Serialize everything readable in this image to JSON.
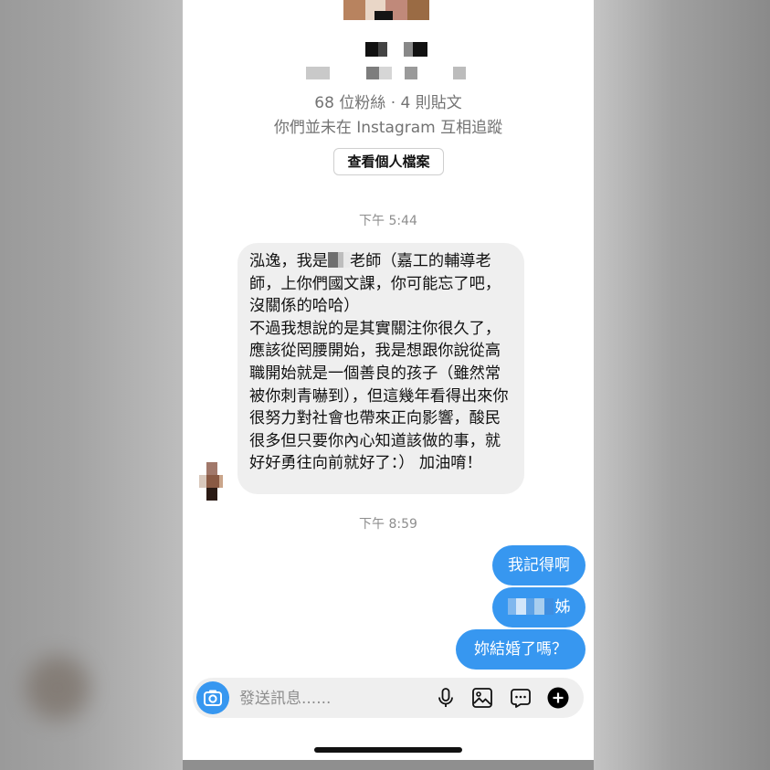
{
  "profile": {
    "stats": "68 位粉絲 · 4 則貼文",
    "mutual_status": "你們並未在 Instagram 互相追蹤",
    "view_profile_label": "查看個人檔案"
  },
  "conversation": {
    "time_1": "下午 5:44",
    "incoming_message": {
      "line1_a": "泓逸，我是",
      "line1_b": "老師（嘉工的輔導老師，上你們國文課，你可能忘了吧，沒關係的哈哈）",
      "para2": "不過我想說的是其實關注你很久了，應該從罔腰開始，我是想跟你說從高職開始就是一個善良的孩子（雖然常被你刺青嚇到），但這幾年看得出來你很努力對社會也帶來正向影響，酸民很多但只要你內心知道該做的事，就好好勇往向前就好了：） 加油唷！"
    },
    "time_2": "下午 8:59",
    "outgoing_messages": {
      "msg1": "我記得啊",
      "msg2_visible": "姊",
      "msg3": "妳結婚了嗎？"
    }
  },
  "composer": {
    "placeholder": "發送訊息......"
  },
  "colors": {
    "accent": "#3797f0",
    "incoming_bubble": "#efefef",
    "secondary_text": "#737373"
  },
  "icons": [
    "camera-icon",
    "microphone-icon",
    "image-icon",
    "sticker-icon",
    "plus-icon"
  ]
}
